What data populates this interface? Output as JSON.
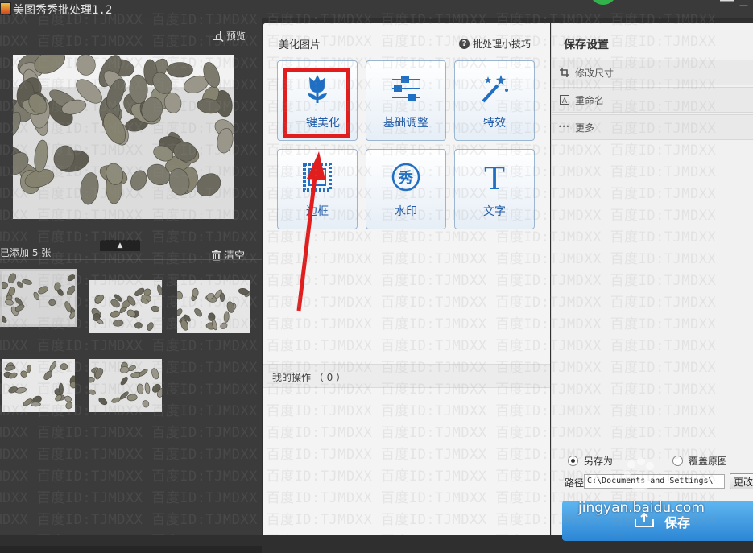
{
  "titlebar": {
    "title": "美图秀秀批处理1.2"
  },
  "watermark": {
    "text": ":TJMDXX 百度ID:TJMDXX 百度ID:TJMDXX 百度ID:TJMDXX 百度ID:TJMDXX 百度ID:TJMDXX 百度ID:TJMDXX"
  },
  "left": {
    "preview_label": "预览",
    "count_label": "已添加 5 张",
    "clear_label": "清空"
  },
  "middle": {
    "title": "美化图片",
    "tips_label": "批处理小技巧",
    "tools": [
      {
        "label": "一键美化",
        "icon": "tulip-icon"
      },
      {
        "label": "基础调整",
        "icon": "sliders-icon"
      },
      {
        "label": "特效",
        "icon": "magic-wand-icon"
      },
      {
        "label": "边框",
        "icon": "frame-icon"
      },
      {
        "label": "水印",
        "icon": "watermark-xiu-icon"
      },
      {
        "label": "文字",
        "icon": "text-t-icon"
      }
    ],
    "text_icon_glyph": "T",
    "watermark_icon_glyph": "秀",
    "ops_label": "我的操作 （ 0 ）"
  },
  "right": {
    "title": "保存设置",
    "rows": [
      {
        "label": "修改尺寸",
        "icon": "crop-icon"
      },
      {
        "label": "重命名",
        "icon": "rename-a-icon"
      },
      {
        "label": "更多",
        "icon": "more-dots-icon"
      }
    ],
    "rename_glyph": "A",
    "more_glyph": "•••",
    "save_as_label": "另存为",
    "overwrite_label": "覆盖原图",
    "path_label": "路径",
    "path_value": "C:\\Documents and Settings\\",
    "change_label": "更改",
    "save_label": "保存"
  },
  "overlay": {
    "site_watermark": "jingyan.baidu.com"
  },
  "colors": {
    "highlight": "#e21d1d",
    "accent_blue": "#1f5ba8",
    "save_blue": "#2d86d4"
  }
}
